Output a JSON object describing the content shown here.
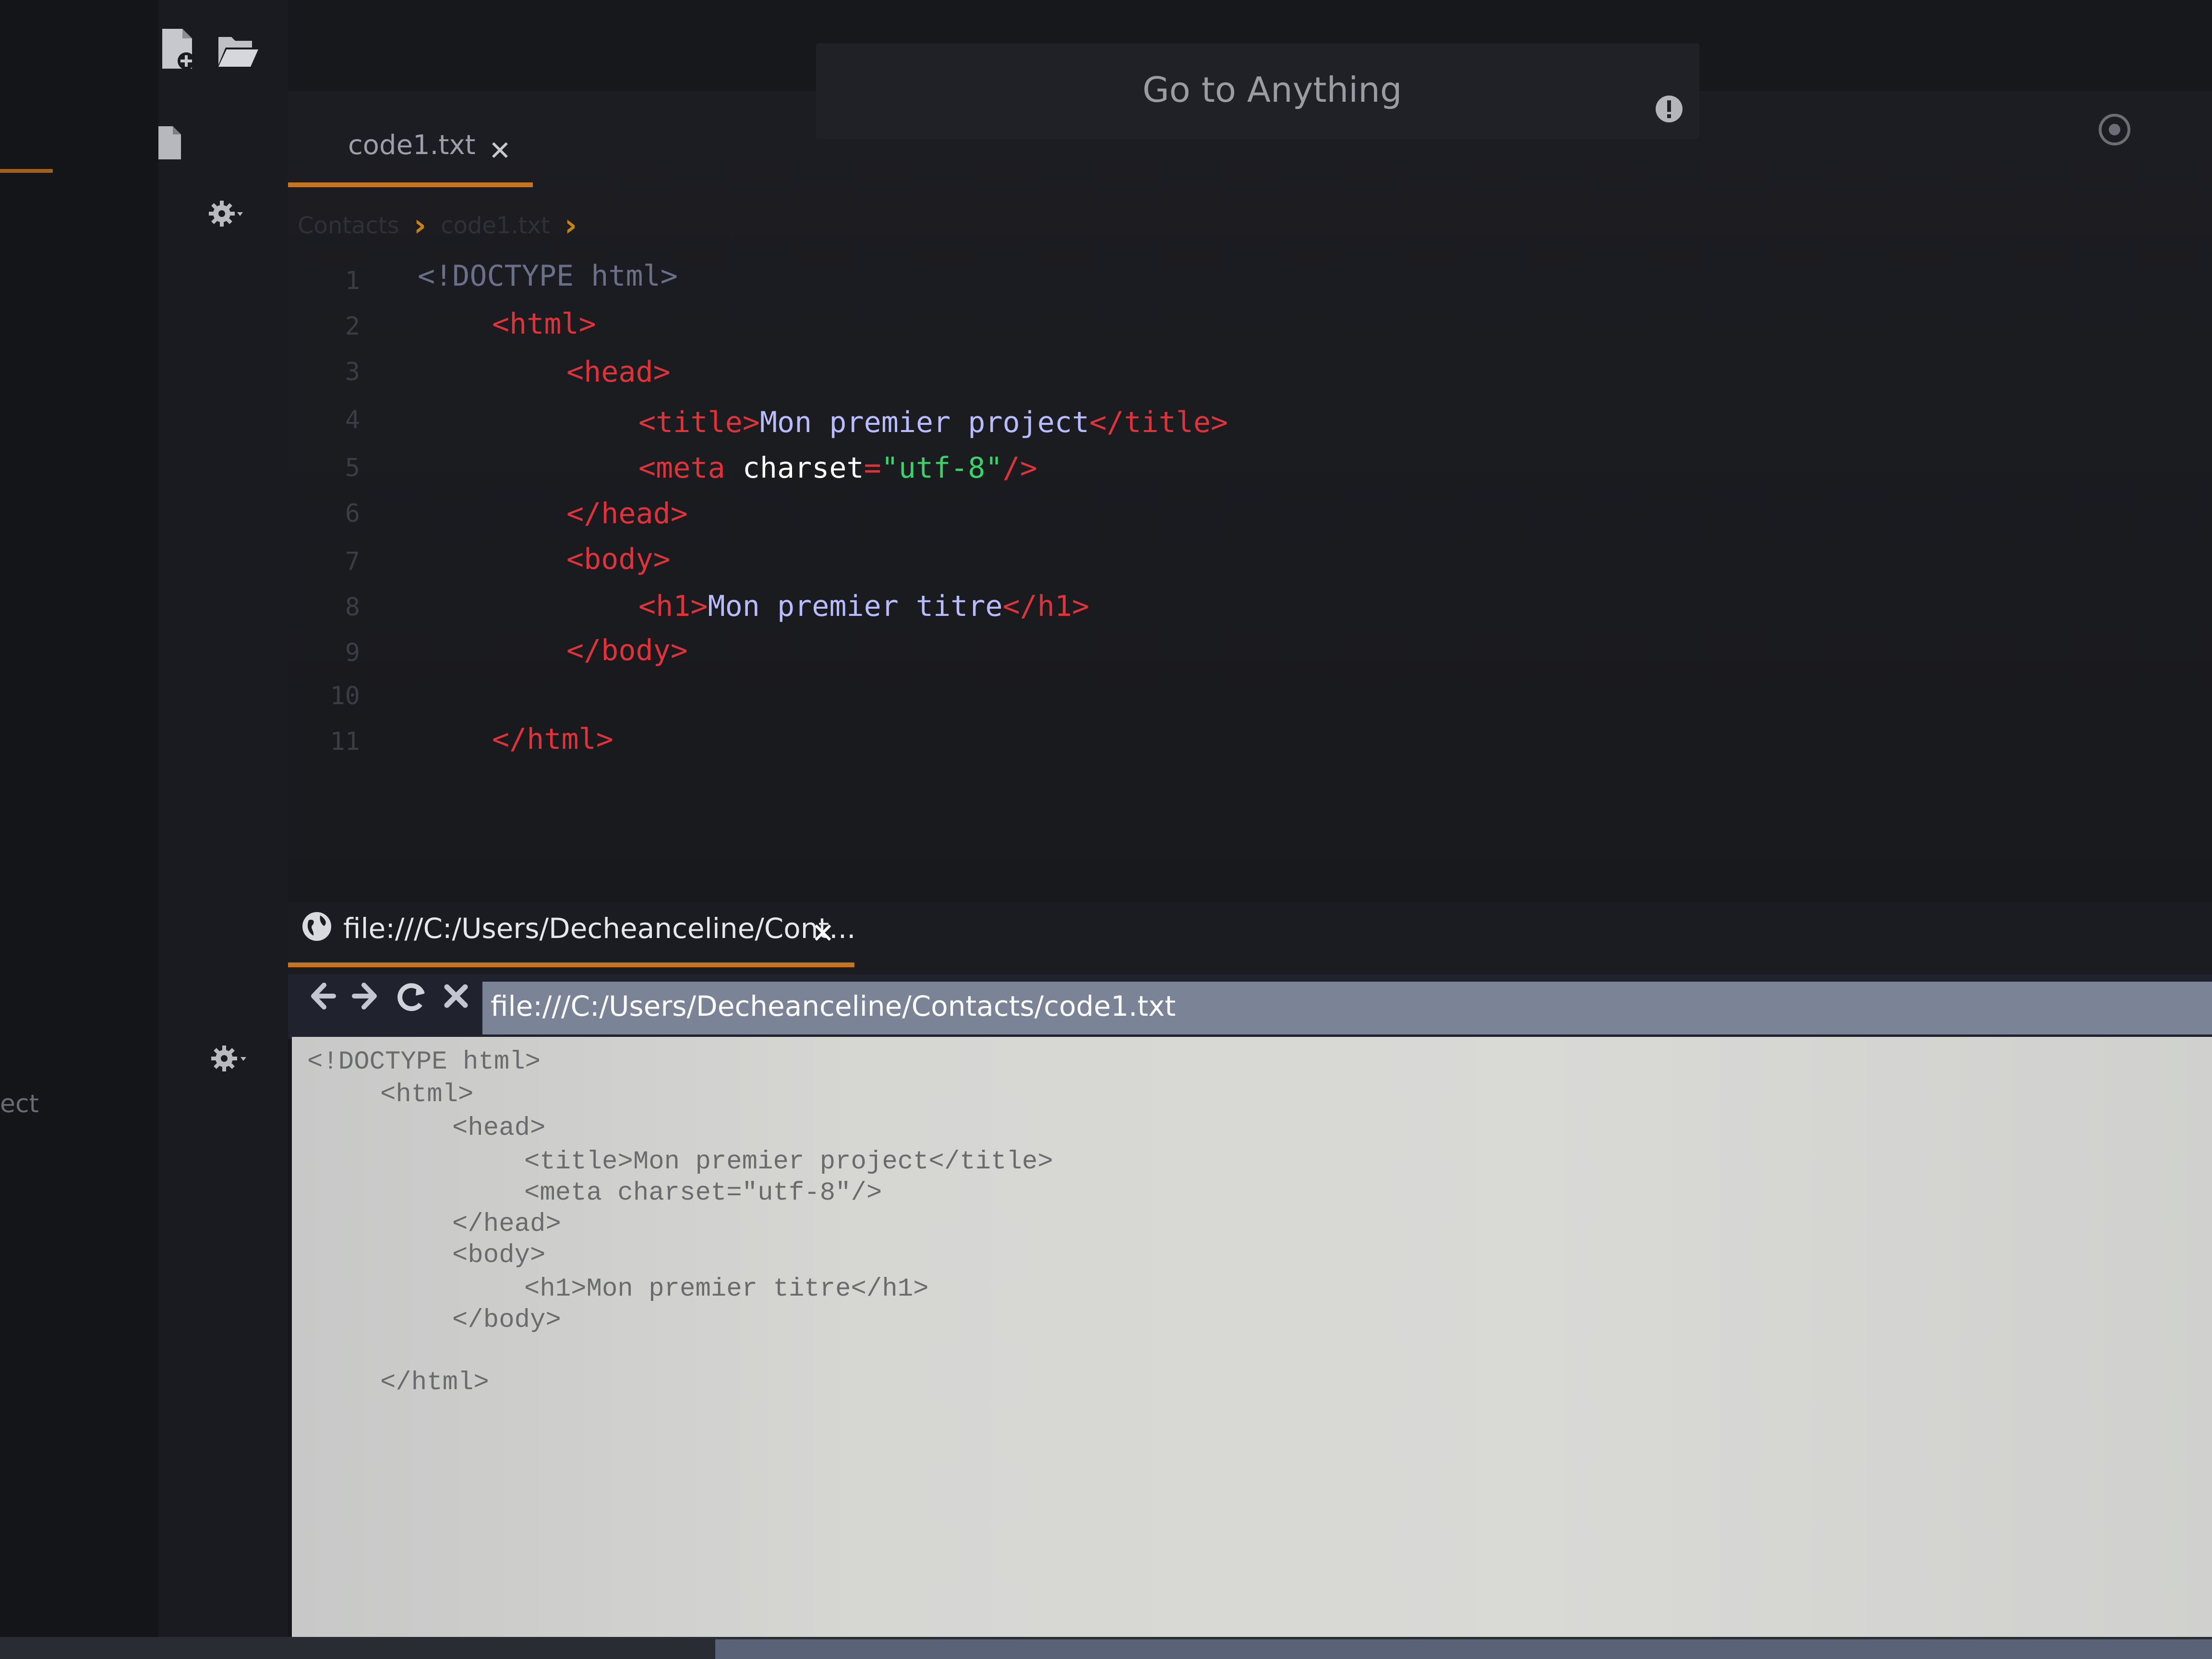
{
  "topbar": {
    "goto_label": "Go to Anything"
  },
  "editor": {
    "tab_label": "code1.txt",
    "tab_close": "✕",
    "breadcrumb": [
      "Contacts",
      "code1.txt"
    ],
    "line_numbers": [
      "1",
      "2",
      "3",
      "4",
      "5",
      "6",
      "7",
      "8",
      "9",
      "10",
      "11"
    ],
    "lines": [
      [
        {
          "t": "<!DOCTYPE html>",
          "c": "doc"
        }
      ],
      [
        {
          "t": "<html>",
          "c": "tag"
        }
      ],
      [
        {
          "t": "<head>",
          "c": "tag"
        }
      ],
      [
        {
          "t": "<title>",
          "c": "tag"
        },
        {
          "t": "Mon premier project",
          "c": "text"
        },
        {
          "t": "</title>",
          "c": "tag"
        }
      ],
      [
        {
          "t": "<meta ",
          "c": "tag"
        },
        {
          "t": "charset",
          "c": "attr"
        },
        {
          "t": "=",
          "c": "eq"
        },
        {
          "t": "\"utf-8\"",
          "c": "str"
        },
        {
          "t": "/>",
          "c": "tag"
        }
      ],
      [
        {
          "t": "</head>",
          "c": "tag"
        }
      ],
      [
        {
          "t": "<body>",
          "c": "tag"
        }
      ],
      [
        {
          "t": "<h1>",
          "c": "tag"
        },
        {
          "t": "Mon premier titre",
          "c": "text"
        },
        {
          "t": "</h1>",
          "c": "tag"
        }
      ],
      [
        {
          "t": "</body>",
          "c": "tag"
        }
      ],
      [],
      [
        {
          "t": "</html>",
          "c": "tag"
        }
      ]
    ]
  },
  "browser": {
    "tab_label": "file:///C:/Users/Decheanceline/Cont...",
    "tab_close": "✕",
    "url": "file:///C:/Users/Decheanceline/Contacts/code1.txt",
    "content_lines": [
      "<!DOCTYPE html>",
      "<html>",
      "<head>",
      "<title>Mon premier project</title>",
      "<meta charset=\"utf-8\"/>",
      "</head>",
      "<body>",
      "<h1>Mon premier titre</h1>",
      "</body>",
      "",
      "</html>"
    ]
  },
  "sidebar": {
    "partial_label": "ect"
  },
  "colors": {
    "accent": "#c8741d",
    "tag": "#e0323a",
    "text": "#b8bcff",
    "string": "#39d36a",
    "attr": "#ffffff"
  }
}
